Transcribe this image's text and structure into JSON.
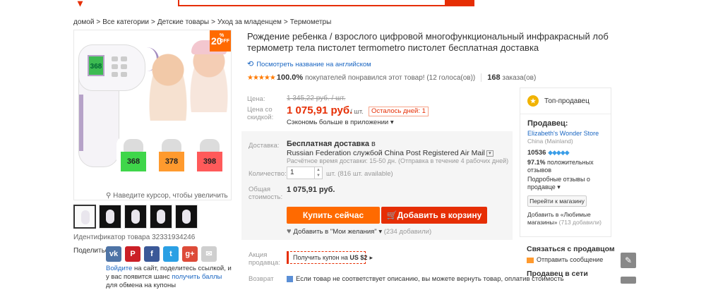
{
  "breadcrumb": [
    "домой",
    "Все категории",
    "Детские товары",
    "Уход за младенцем",
    "Термометры"
  ],
  "breadcrumb_sep": ">",
  "gallery": {
    "discount_badge": "20",
    "badge_pct": "%",
    "badge_off": "OFF",
    "main_screen_value": "368",
    "mini_values": [
      "368",
      "378",
      "398"
    ],
    "zoom_hint": "Наведите курсор, чтобы увеличить",
    "item_id": "Идентификатор товара 32331934246"
  },
  "share": {
    "label": "Поделиться:",
    "networks": [
      {
        "name": "vk",
        "glyph": "vk",
        "color": "#4e74a6"
      },
      {
        "name": "pinterest",
        "glyph": "P",
        "color": "#cb2027"
      },
      {
        "name": "facebook",
        "glyph": "f",
        "color": "#3b5998"
      },
      {
        "name": "twitter",
        "glyph": "t",
        "color": "#2ba0e4"
      },
      {
        "name": "google-plus",
        "glyph": "g+",
        "color": "#dd4b39"
      },
      {
        "name": "email",
        "glyph": "✉",
        "color": "#cfcfcf"
      }
    ],
    "text_link1": "Войдите",
    "text_mid": " на сайт, поделитесь ссылкой, и у вас появится шанс ",
    "text_link2": "получить баллы",
    "text_end": " для обмена на купоны"
  },
  "product": {
    "title": "Рождение ребенка / взрослого цифровой многофункциональный инфракрасный лоб термометр тела пистолет termometro пистолет бесплатная доставка",
    "translate_link": "Посмотреть название на английском",
    "rating_stars": "★★★★★",
    "rating_pct": "100.0%",
    "rating_desc": "покупателей понравился этот товар! (12 голоса(ов))",
    "orders_count": "168",
    "orders_label": " заказа(ов)"
  },
  "price": {
    "label_price": "Цена:",
    "old_price": "1 345,22 руб. / шт.",
    "label_discount": "Цена со скидкой:",
    "new_price": "1 075,91 руб.",
    "per_unit": "/ шт.",
    "days_left": "Осталось дней: 1",
    "app_save": "Сэкономь больше в приложении"
  },
  "shipping": {
    "label": "Доставка:",
    "free_label": "Бесплатная доставка",
    "to_word": " в",
    "destination": "Russian Federation службой China Post Registered Air Mail",
    "time_note": "Расчётное время доставки: 15-50 дн. (Отправка в течение 4 рабочих дней)"
  },
  "quantity": {
    "label": "Количество:",
    "value": "1",
    "available": "шт. (816 шт. available)"
  },
  "total": {
    "label": "Общая стоимость:",
    "value": "1 075,91 руб."
  },
  "actions": {
    "buy_now": "Купить сейчас",
    "add_to_cart": "Добавить в корзину",
    "wishlist": "Добавить в \"Мои желания\"",
    "wishlist_count": "(234 добавили)"
  },
  "promo": {
    "label": "Акция продавца:",
    "coupon_text": "Получить купон на ",
    "coupon_value": "US $2",
    "coupon_arrow": "▸"
  },
  "returns": {
    "label": "Возврат",
    "text": "Если товар не соответствует описанию, вы можете вернуть товар, оплатив стоимость"
  },
  "seller": {
    "top_seller": "Топ-продавец",
    "section_title": "Продавец:",
    "store_name": "Elizabeth's Wonder Store",
    "country": "China (Mainland)",
    "score": "10536",
    "diamonds": "◆◆◆◆◆",
    "feedback_pct": "97.1%",
    "feedback_text": " положительных отзывов",
    "history_text": "Подробные отзывы о продавце",
    "go_store": "Перейти к магазину",
    "fav_text": "Добавить в «Любимые магазины»",
    "fav_count": "(713 добавили)"
  },
  "contact": {
    "title": "Связаться с продавцом",
    "message": "Отправить сообщение",
    "network": "Продавец в сети"
  },
  "colors": {
    "accent": "#e62e04",
    "orange": "#ff6a00",
    "link": "#1a66c2"
  }
}
